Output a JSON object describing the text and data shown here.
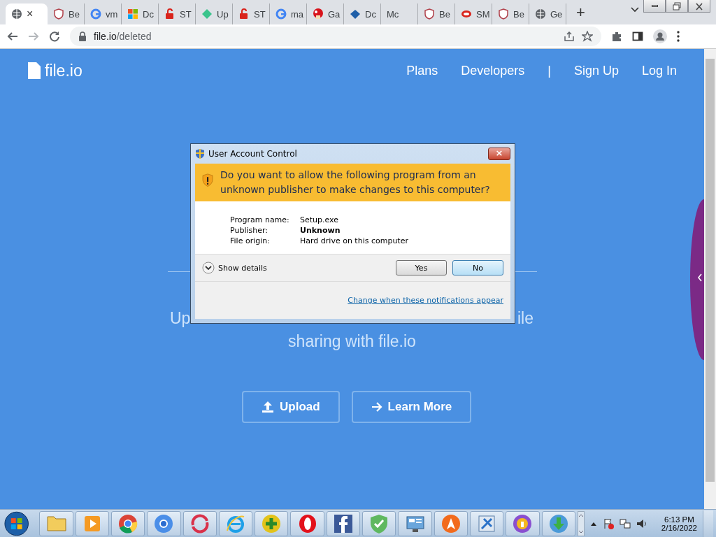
{
  "browser": {
    "tabs": [
      {
        "kind": "globe",
        "selected": true
      },
      {
        "label": "Be",
        "kind": "shield",
        "selected": false
      },
      {
        "label": "vm",
        "kind": "google",
        "selected": false
      },
      {
        "label": "Dc",
        "kind": "windows",
        "selected": false
      },
      {
        "label": "ST",
        "kind": "lock",
        "selected": false
      },
      {
        "label": "Up",
        "kind": "leaf",
        "selected": false
      },
      {
        "label": "ST",
        "kind": "lock",
        "selected": false
      },
      {
        "label": "ma",
        "kind": "google",
        "selected": false
      },
      {
        "label": "Ga",
        "kind": "mushroom",
        "selected": false
      },
      {
        "label": "Dc",
        "kind": "diamond",
        "selected": false
      },
      {
        "label": "Mc",
        "kind": "blank",
        "selected": false
      },
      {
        "label": "Be",
        "kind": "shield",
        "selected": false
      },
      {
        "label": "SM",
        "kind": "pill",
        "selected": false
      },
      {
        "label": "Be",
        "kind": "shield",
        "selected": false
      },
      {
        "label": "Ge",
        "kind": "globe",
        "selected": false
      }
    ],
    "new_tab": "+",
    "close_tab": "×",
    "address": {
      "host": "file.io",
      "path": "/deleted"
    }
  },
  "page": {
    "logo": "file.io",
    "nav": [
      {
        "label": "Plans"
      },
      {
        "label": "Developers"
      },
      {
        "label": "|"
      },
      {
        "label": "Sign Up"
      },
      {
        "label": "Log In"
      }
    ],
    "hero_fragments": [
      "Up",
      "ile"
    ],
    "hero_line_2": "sharing with file.io",
    "buttons": [
      {
        "label": "Upload",
        "kind": "upload"
      },
      {
        "label": "Learn More",
        "kind": "arrow"
      }
    ]
  },
  "dialog": {
    "title": "User Account Control",
    "close": "×",
    "question": "Do you want to allow the following program from an unknown publisher to make changes to this computer?",
    "fields": [
      {
        "label": "Program name:",
        "value": "Setup.exe",
        "bold": false
      },
      {
        "label": "Publisher:",
        "value": "Unknown",
        "bold": true
      },
      {
        "label": "File origin:",
        "value": "Hard drive on this computer",
        "bold": false
      }
    ],
    "details": "Show details",
    "buttons": [
      {
        "label": "Yes",
        "selected": false
      },
      {
        "label": "No",
        "selected": true
      }
    ],
    "link": "Change when these notifications appear"
  },
  "taskbar": {
    "apps": [
      {
        "kind": "folder"
      },
      {
        "kind": "media"
      },
      {
        "kind": "chrome"
      },
      {
        "kind": "chromium"
      },
      {
        "kind": "swirl"
      },
      {
        "kind": "ie"
      },
      {
        "kind": "plus"
      },
      {
        "kind": "opera"
      },
      {
        "kind": "facebook"
      },
      {
        "kind": "shield"
      },
      {
        "kind": "panel"
      },
      {
        "kind": "avast"
      },
      {
        "kind": "tool"
      },
      {
        "kind": "vpn"
      },
      {
        "kind": "download"
      }
    ],
    "time": "6:13 PM",
    "date": "2/16/2022"
  }
}
